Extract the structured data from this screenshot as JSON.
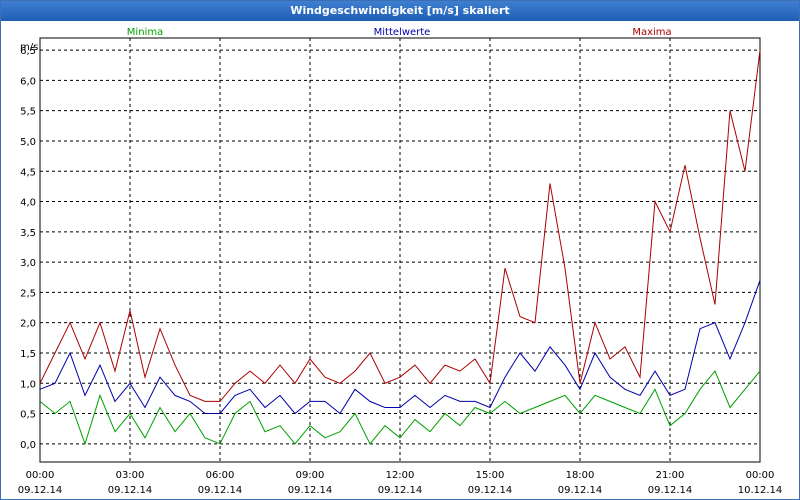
{
  "window_title": "Windgeschwindigkeit [m/s] skaliert",
  "colors": {
    "minima": "#00a000",
    "mittel": "#0000aa",
    "maxima": "#aa0000",
    "title_bar": "#2a63b8"
  },
  "chart_data": {
    "type": "line",
    "title": "Windgeschwindigkeit [m/s] skaliert",
    "ylabel": "m/s",
    "xlabel": "",
    "ylim": [
      -0.3,
      6.7
    ],
    "yticks": [
      "6,5",
      "6,0",
      "5,5",
      "5,0",
      "4,5",
      "4,0",
      "3,5",
      "3,0",
      "2,5",
      "2,0",
      "1,5",
      "1,0",
      "0,5",
      "0,0"
    ],
    "ytick_values": [
      6.5,
      6.0,
      5.5,
      5.0,
      4.5,
      4.0,
      3.5,
      3.0,
      2.5,
      2.0,
      1.5,
      1.0,
      0.5,
      0.0
    ],
    "xlim_hours": [
      0,
      24
    ],
    "xticks": [
      {
        "hour": 0,
        "time": "00:00",
        "date": "09.12.14"
      },
      {
        "hour": 3,
        "time": "03:00",
        "date": "09.12.14"
      },
      {
        "hour": 6,
        "time": "06:00",
        "date": "09.12.14"
      },
      {
        "hour": 9,
        "time": "09:00",
        "date": "09.12.14"
      },
      {
        "hour": 12,
        "time": "12:00",
        "date": "09.12.14"
      },
      {
        "hour": 15,
        "time": "15:00",
        "date": "09.12.14"
      },
      {
        "hour": 18,
        "time": "18:00",
        "date": "09.12.14"
      },
      {
        "hour": 21,
        "time": "21:00",
        "date": "09.12.14"
      },
      {
        "hour": 24,
        "time": "00:00",
        "date": "10.12.14"
      }
    ],
    "grid": true,
    "legend_position": "top",
    "series": [
      {
        "name": "Minima",
        "color": "#00a000",
        "x": [
          0,
          0.5,
          1,
          1.5,
          2,
          2.5,
          3,
          3.5,
          4,
          4.5,
          5,
          5.5,
          6,
          6.5,
          7,
          7.5,
          8,
          8.5,
          9,
          9.5,
          10,
          10.5,
          11,
          11.5,
          12,
          12.5,
          13,
          13.5,
          14,
          14.5,
          15,
          15.5,
          16,
          16.5,
          17,
          17.5,
          18,
          18.5,
          19,
          19.5,
          20,
          20.5,
          21,
          21.5,
          22,
          22.5,
          23,
          23.5,
          24
        ],
        "values": [
          0.7,
          0.5,
          0.7,
          0.0,
          0.8,
          0.2,
          0.5,
          0.1,
          0.6,
          0.2,
          0.5,
          0.1,
          0.0,
          0.5,
          0.7,
          0.2,
          0.3,
          0.0,
          0.3,
          0.1,
          0.2,
          0.5,
          0.0,
          0.3,
          0.1,
          0.4,
          0.2,
          0.5,
          0.3,
          0.6,
          0.5,
          0.7,
          0.5,
          0.6,
          0.7,
          0.8,
          0.5,
          0.8,
          0.7,
          0.6,
          0.5,
          0.9,
          0.3,
          0.5,
          0.9,
          1.2,
          0.6,
          0.9,
          1.2
        ]
      },
      {
        "name": "Mittelwerte",
        "color": "#0000aa",
        "x": [
          0,
          0.5,
          1,
          1.5,
          2,
          2.5,
          3,
          3.5,
          4,
          4.5,
          5,
          5.5,
          6,
          6.5,
          7,
          7.5,
          8,
          8.5,
          9,
          9.5,
          10,
          10.5,
          11,
          11.5,
          12,
          12.5,
          13,
          13.5,
          14,
          14.5,
          15,
          15.5,
          16,
          16.5,
          17,
          17.5,
          18,
          18.5,
          19,
          19.5,
          20,
          20.5,
          21,
          21.5,
          22,
          22.5,
          23,
          23.5,
          24
        ],
        "values": [
          0.9,
          1.0,
          1.5,
          0.8,
          1.3,
          0.7,
          1.0,
          0.6,
          1.1,
          0.8,
          0.7,
          0.5,
          0.5,
          0.8,
          0.9,
          0.6,
          0.8,
          0.5,
          0.7,
          0.7,
          0.5,
          0.9,
          0.7,
          0.6,
          0.6,
          0.8,
          0.6,
          0.8,
          0.7,
          0.7,
          0.6,
          1.1,
          1.5,
          1.2,
          1.6,
          1.3,
          0.9,
          1.5,
          1.1,
          0.9,
          0.8,
          1.2,
          0.8,
          0.9,
          1.9,
          2.0,
          1.4,
          2.0,
          2.7
        ]
      },
      {
        "name": "Maxima",
        "color": "#aa0000",
        "x": [
          0,
          0.5,
          1,
          1.5,
          2,
          2.5,
          3,
          3.5,
          4,
          4.5,
          5,
          5.5,
          6,
          6.5,
          7,
          7.5,
          8,
          8.5,
          9,
          9.5,
          10,
          10.5,
          11,
          11.5,
          12,
          12.5,
          13,
          13.5,
          14,
          14.5,
          15,
          15.5,
          16,
          16.5,
          17,
          17.5,
          18,
          18.5,
          19,
          19.5,
          20,
          20.5,
          21,
          21.5,
          22,
          22.5,
          23,
          23.5,
          24
        ],
        "values": [
          1.0,
          1.5,
          2.0,
          1.4,
          2.0,
          1.2,
          2.2,
          1.1,
          1.9,
          1.3,
          0.8,
          0.7,
          0.7,
          1.0,
          1.2,
          1.0,
          1.3,
          1.0,
          1.4,
          1.1,
          1.0,
          1.2,
          1.5,
          1.0,
          1.1,
          1.3,
          1.0,
          1.3,
          1.2,
          1.4,
          1.0,
          2.9,
          2.1,
          2.0,
          4.3,
          2.9,
          1.0,
          2.0,
          1.4,
          1.6,
          1.1,
          4.0,
          3.5,
          4.6,
          3.4,
          2.3,
          5.5,
          4.5,
          6.5
        ]
      }
    ]
  }
}
